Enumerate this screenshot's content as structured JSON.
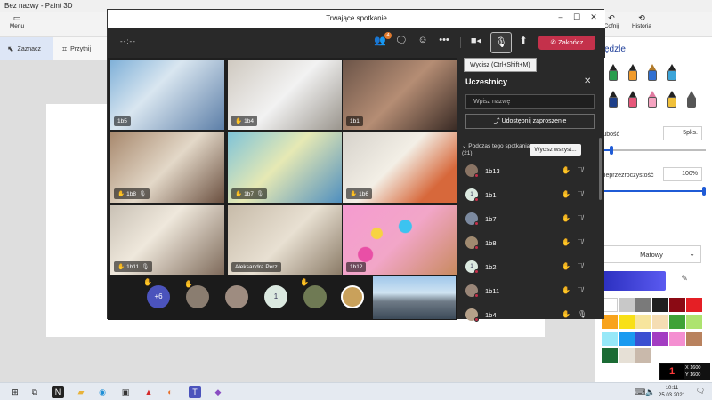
{
  "paint": {
    "title": "Bez nazwy - Paint 3D",
    "menu_label": "Menu",
    "select_label": "Zaznacz",
    "crop_label": "Przytnij",
    "history_label": "Historia",
    "undo_label": "Cofnij",
    "panel_title": "ędzle",
    "thickness_label": "rubość",
    "thickness_value": "5pks.",
    "thickness_fraction": 0.12,
    "opacity_label": "nieprzezroczystość",
    "opacity_value": "100%",
    "opacity_fraction": 1.0,
    "material": "Matowy",
    "palette": [
      "#ffffff",
      "#c8c8c8",
      "#7a7a7a",
      "#202020",
      "#8b0a14",
      "#e51f25",
      "#f8a31b",
      "#f8e017",
      "#f7e59d",
      "#f5ddb3",
      "#3fa237",
      "#ade36f",
      "#96e8f8",
      "#1a9af0",
      "#3b4fd1",
      "#a33cc2",
      "#f48fd1",
      "#b9825e",
      "#1b6b34",
      "#e6e0d6",
      "#c9b9ab"
    ]
  },
  "teams": {
    "window_title": "Trwające spotkanie",
    "timer": "--:--",
    "participants_badge": "4",
    "end_label": "Zakończ",
    "tooltip": "Wycisz (Ctrl+Shift+M)",
    "tiles": [
      {
        "name": "1b5",
        "hand": false,
        "mic": false
      },
      {
        "name": "1b4",
        "hand": true,
        "mic": false
      },
      {
        "name": "1b1",
        "hand": false,
        "mic": false
      },
      {
        "name": "1b8",
        "hand": true,
        "mic": true
      },
      {
        "name": "1b7",
        "hand": true,
        "mic": true
      },
      {
        "name": "1b6",
        "hand": true,
        "mic": false
      },
      {
        "name": "1b11",
        "hand": true,
        "mic": true
      },
      {
        "name": "Aleksandra Perz",
        "hand": false,
        "mic": false
      },
      {
        "name": "1b12",
        "hand": false,
        "mic": false
      }
    ],
    "overflow_count": "+6",
    "strip_avatar_initial": "1",
    "panel": {
      "title": "Uczestnicy",
      "search_placeholder": "Wpisz nazwę",
      "share_label": "Udostępnij zaproszenie",
      "section_label": "Podczas tego spotkania",
      "section_count": "(21)",
      "mute_all_label": "Wycisz wszyst...",
      "people": [
        {
          "name": "1b13",
          "avatar": "photo"
        },
        {
          "name": "1b1",
          "avatar": "1"
        },
        {
          "name": "1b7",
          "avatar": "photo"
        },
        {
          "name": "1b8",
          "avatar": "photo"
        },
        {
          "name": "1b2",
          "avatar": "1"
        },
        {
          "name": "1b11",
          "avatar": "photo"
        },
        {
          "name": "1b4",
          "avatar": "photo"
        }
      ]
    }
  },
  "taskbar": {
    "time": "10:11",
    "date": "25.03.2021",
    "notification_count": "2"
  },
  "overlay": {
    "x_readout": "X 1600",
    "y_readout": "Y 1600"
  }
}
